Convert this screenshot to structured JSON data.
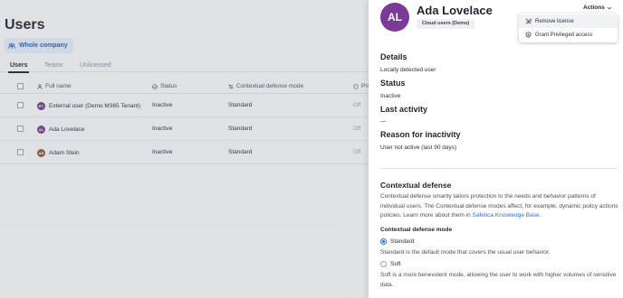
{
  "page": {
    "title": "Users",
    "filter_chip": "Whole company",
    "tabs": [
      "Users",
      "Teams",
      "Unlicensed"
    ],
    "table": {
      "columns": [
        "Full name",
        "Status",
        "Contextual defense mode",
        "Pri"
      ],
      "rows": [
        {
          "initials": "ET",
          "avatar_color": "#6b3a8a",
          "name": "External user (Demo M365 Tenant)",
          "status": "Inactive",
          "mode": "Standard",
          "extra": "Off"
        },
        {
          "initials": "AL",
          "avatar_color": "#7b3a96",
          "name": "Ada Lovelace",
          "status": "Inactive",
          "mode": "Standard",
          "extra": "Off"
        },
        {
          "initials": "AS",
          "avatar_color": "#8a5a3a",
          "name": "Adam Stein",
          "status": "Inactive",
          "mode": "Standard",
          "extra": "Off"
        }
      ]
    }
  },
  "panel": {
    "avatar_initials": "AL",
    "avatar_color": "#7b3a96",
    "name": "Ada Lovelace",
    "badge": "Cloud users (Demo)",
    "actions_label": "Actions",
    "menu": {
      "items": [
        "Remove license",
        "Grant Privileged access"
      ]
    },
    "details": {
      "heading": "Details",
      "value": "Locally detected user"
    },
    "status": {
      "heading": "Status",
      "value": "Inactive"
    },
    "last_activity": {
      "heading": "Last activity",
      "value": "—"
    },
    "reason": {
      "heading": "Reason for inactivity",
      "value": "User not active (last 90 days)"
    },
    "contextual_defense": {
      "title": "Contextual defense",
      "description": "Contextual defense smartly tailors protection to the needs and behavior patterns of individual users. The Contextual defense modes affect, for example, dynamic policy actions policies. Learn more about them in ",
      "link_text": "Safetica Knowledge Base",
      "after_link": ".",
      "mode_label": "Contextual defense mode",
      "options": [
        {
          "label": "Standard",
          "selected": true,
          "description": "Standard is the default mode that covers the usual user behavior."
        },
        {
          "label": "Soft",
          "selected": false,
          "description": "Soft is a more benevolent mode, allowing the user to work with higher volumes of sensitive data."
        }
      ]
    }
  },
  "colors": {
    "accent": "#2d6fd6",
    "avatar_purple": "#7b3a96"
  }
}
